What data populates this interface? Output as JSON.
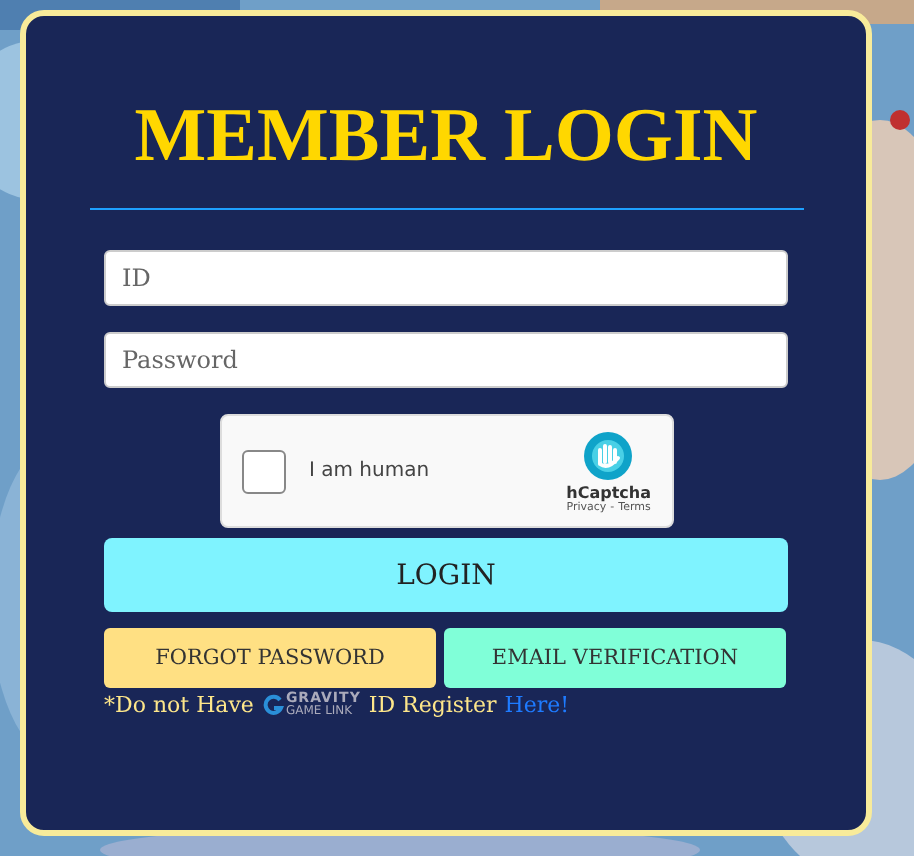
{
  "title": "MEMBER LOGIN",
  "fields": [
    {
      "placeholder": "ID"
    },
    {
      "placeholder": "Password"
    }
  ],
  "captcha": {
    "label": "I am human",
    "checked": false,
    "brand": "hCaptcha",
    "privacy": "Privacy",
    "separator": "-",
    "terms": "Terms"
  },
  "login_button": "LOGIN",
  "buttons": [
    {
      "label": "FORGOT PASSWORD",
      "color": "#ffe083"
    },
    {
      "label": "EMAIL VERIFICATION",
      "color": "#80ffd8"
    }
  ],
  "footer": {
    "before": "*Do not Have",
    "logo_name": "GRAVITY",
    "logo_sub": "GAME LINK",
    "after": "ID Register",
    "link": "Here!"
  }
}
